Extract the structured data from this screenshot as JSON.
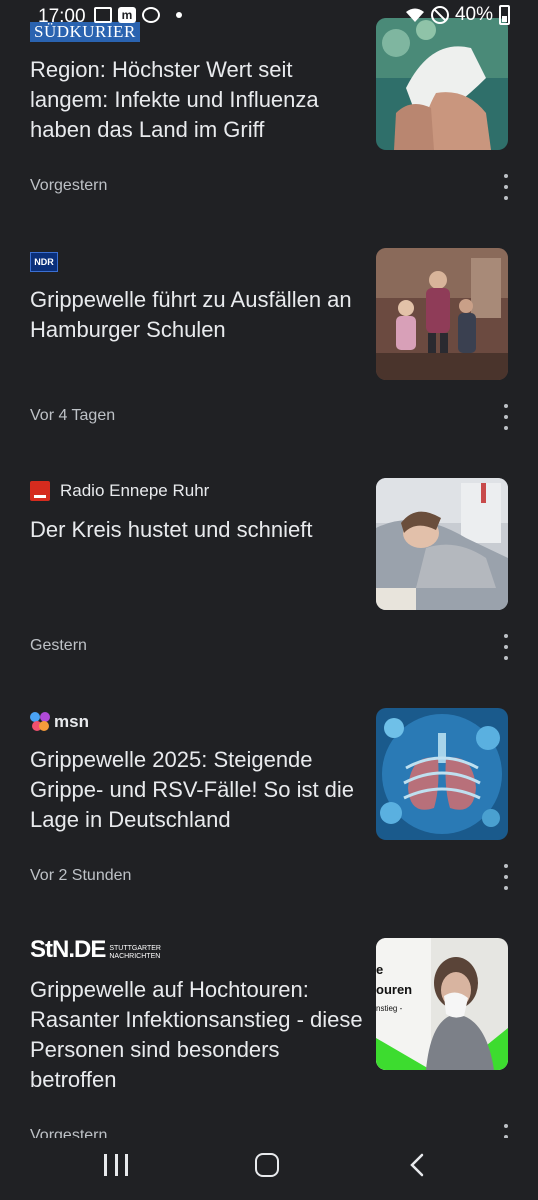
{
  "status_bar": {
    "time": "17:00",
    "battery": "40%",
    "icons": [
      "gallery-icon",
      "mastodon-icon",
      "camera-icon",
      "dot-icon",
      "wifi-icon",
      "dnd-icon",
      "battery-icon"
    ]
  },
  "articles": [
    {
      "source": "SÜDKURIER",
      "source_logo": "suedkurier-logo",
      "headline": "Region: Höchster Wert seit langem: Infekte und Influenza haben das Land im Griff",
      "time": "Vorgestern",
      "thumbnail": "hand-tissue-photo"
    },
    {
      "source": "NDR",
      "source_logo": "ndr-logo",
      "headline": "Grippewelle führt zu Ausfällen an Hamburger Schulen",
      "time": "Vor 4 Tagen",
      "thumbnail": "classroom-photo"
    },
    {
      "source": "Radio Ennepe Ruhr",
      "source_logo": "radio-en-logo",
      "headline": "Der Kreis hustet und schnieft",
      "time": "Gestern",
      "thumbnail": "sick-woman-bed-photo"
    },
    {
      "source": "msn",
      "source_logo": "msn-logo",
      "headline": "Grippewelle 2025: Steigende Grippe- und RSV-Fälle! So ist die Lage in Deutschland",
      "time": "Vor 2 Stunden",
      "thumbnail": "lungs-virus-illustration"
    },
    {
      "source": "StN.DE",
      "source_sub": "STUTTGARTER NACHRICHTEN",
      "source_logo": "stn-logo",
      "headline": "Grippewelle auf Hochtouren: Rasanter Infektionsanstieg - diese Personen sind besonders betroffen",
      "time": "Vorgestern",
      "thumbnail": "woman-tissue-photo",
      "thumb_text_1": "e",
      "thumb_text_2": "ouren",
      "thumb_text_3": "nstieg -"
    }
  ],
  "colors": {
    "background": "#202124",
    "text": "#e8eaed",
    "secondary_text": "#bdc1c6",
    "suedkurier_blue": "#2a63b0",
    "stn_green": "#3ddc2f"
  }
}
